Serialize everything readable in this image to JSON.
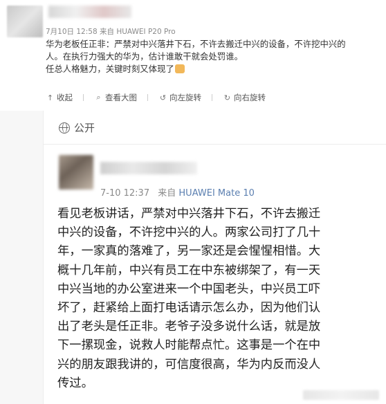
{
  "post": {
    "meta": "7月10日 12:58 来自 HUAWEI P20 Pro",
    "text_lines": [
      "华为老板任正非：严禁对中兴落井下石，不许去搬迁中兴的设备，不许挖中兴的",
      "人。在执行力强大的华为，估计谁敢干就会处罚谁。",
      "任总人格魅力，关键时刻又体现了"
    ],
    "emoji_icon": "thumbs-up-icon"
  },
  "actions": [
    {
      "icon": "favorite-icon",
      "glyph": "↑",
      "label": "收起"
    },
    {
      "icon": "zoom-icon",
      "glyph": "⌕",
      "label": "查看大图"
    },
    {
      "icon": "rotate-left-icon",
      "glyph": "↺",
      "label": "向左旋转"
    },
    {
      "icon": "rotate-right-icon",
      "glyph": "↻",
      "label": "向右旋转"
    }
  ],
  "screenshot": {
    "visibility": "公开",
    "visibility_icon": "globe-icon",
    "time": "7-10 12:37",
    "source_prefix": "来自",
    "device": "HUAWEI Mate 10",
    "text_lines": [
      "看见老板讲话，严禁对中兴落井下石，不许去搬迁",
      "中兴的设备，不许挖中兴的人。两家公司打了几十",
      "年，一家真的落难了，另一家还是会惺惺相惜。大",
      "概十几年前，中兴有员工在中东被绑架了，有一天",
      "中兴当地的办公室进来一个中国老头，中兴员工吓",
      "坏了，赶紧给上面打电话请示怎么办，因为他们认",
      "出了老头是任正非。老爷子没多说什么话，就是放",
      "下一摞现金，说救人时能帮点忙。这事是一个在中",
      "兴的朋友跟我讲的，可信度很高，华为内反而没人",
      "传过。"
    ]
  },
  "colors": {
    "meta_gray": "#8a8a8a",
    "device_blue": "#5b7fb0",
    "text_dark": "#222222"
  }
}
